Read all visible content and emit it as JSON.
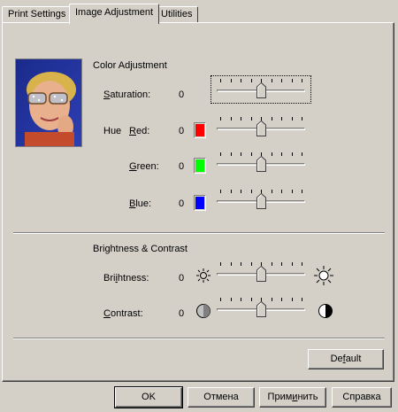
{
  "tabs": [
    "Print Settings",
    "Image Adjustment",
    "Utilities"
  ],
  "active_tab": 1,
  "color_adjustment": {
    "title": "Color Adjustment",
    "saturation": {
      "label": "Saturation:",
      "value": "0",
      "position": 0.5
    },
    "hue_label": "Hue",
    "red": {
      "label": "Red:",
      "value": "0",
      "color": "#ff0000",
      "position": 0.5
    },
    "green": {
      "label": "Green:",
      "value": "0",
      "color": "#00ff00",
      "position": 0.5
    },
    "blue": {
      "label": "Blue:",
      "value": "0",
      "color": "#0000ff",
      "position": 0.5
    }
  },
  "brightness_contrast": {
    "title": "Brightness & Contrast",
    "brightness": {
      "label": "Brightness:",
      "value": "0",
      "position": 0.5,
      "icon_left": "dim-sun-icon",
      "icon_right": "bright-sun-icon"
    },
    "contrast": {
      "label": "Contrast:",
      "value": "0",
      "position": 0.5,
      "icon_left": "low-contrast-icon",
      "icon_right": "high-contrast-icon"
    }
  },
  "preview_image": "portrait-preview",
  "default_button": "Default",
  "footer": {
    "ok": "OK",
    "cancel": "Отмена",
    "apply": "Применить",
    "help": "Справка"
  }
}
